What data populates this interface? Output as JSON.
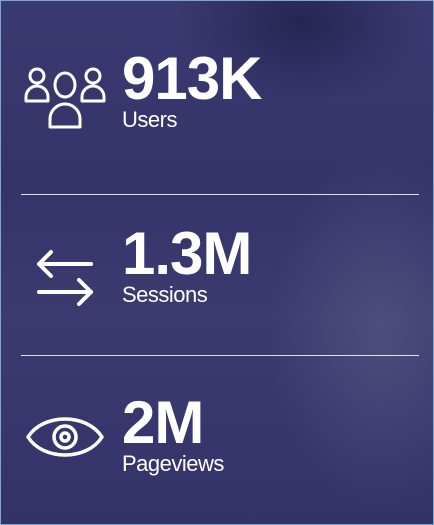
{
  "stats": [
    {
      "icon": "users-icon",
      "value": "913K",
      "label": "Users"
    },
    {
      "icon": "arrows-exchange-icon",
      "value": "1.3M",
      "label": "Sessions"
    },
    {
      "icon": "eye-icon",
      "value": "2M",
      "label": "Pageviews"
    }
  ],
  "colors": {
    "text": "#ffffff",
    "background": "#37376d",
    "border": "#7ea6cc"
  }
}
